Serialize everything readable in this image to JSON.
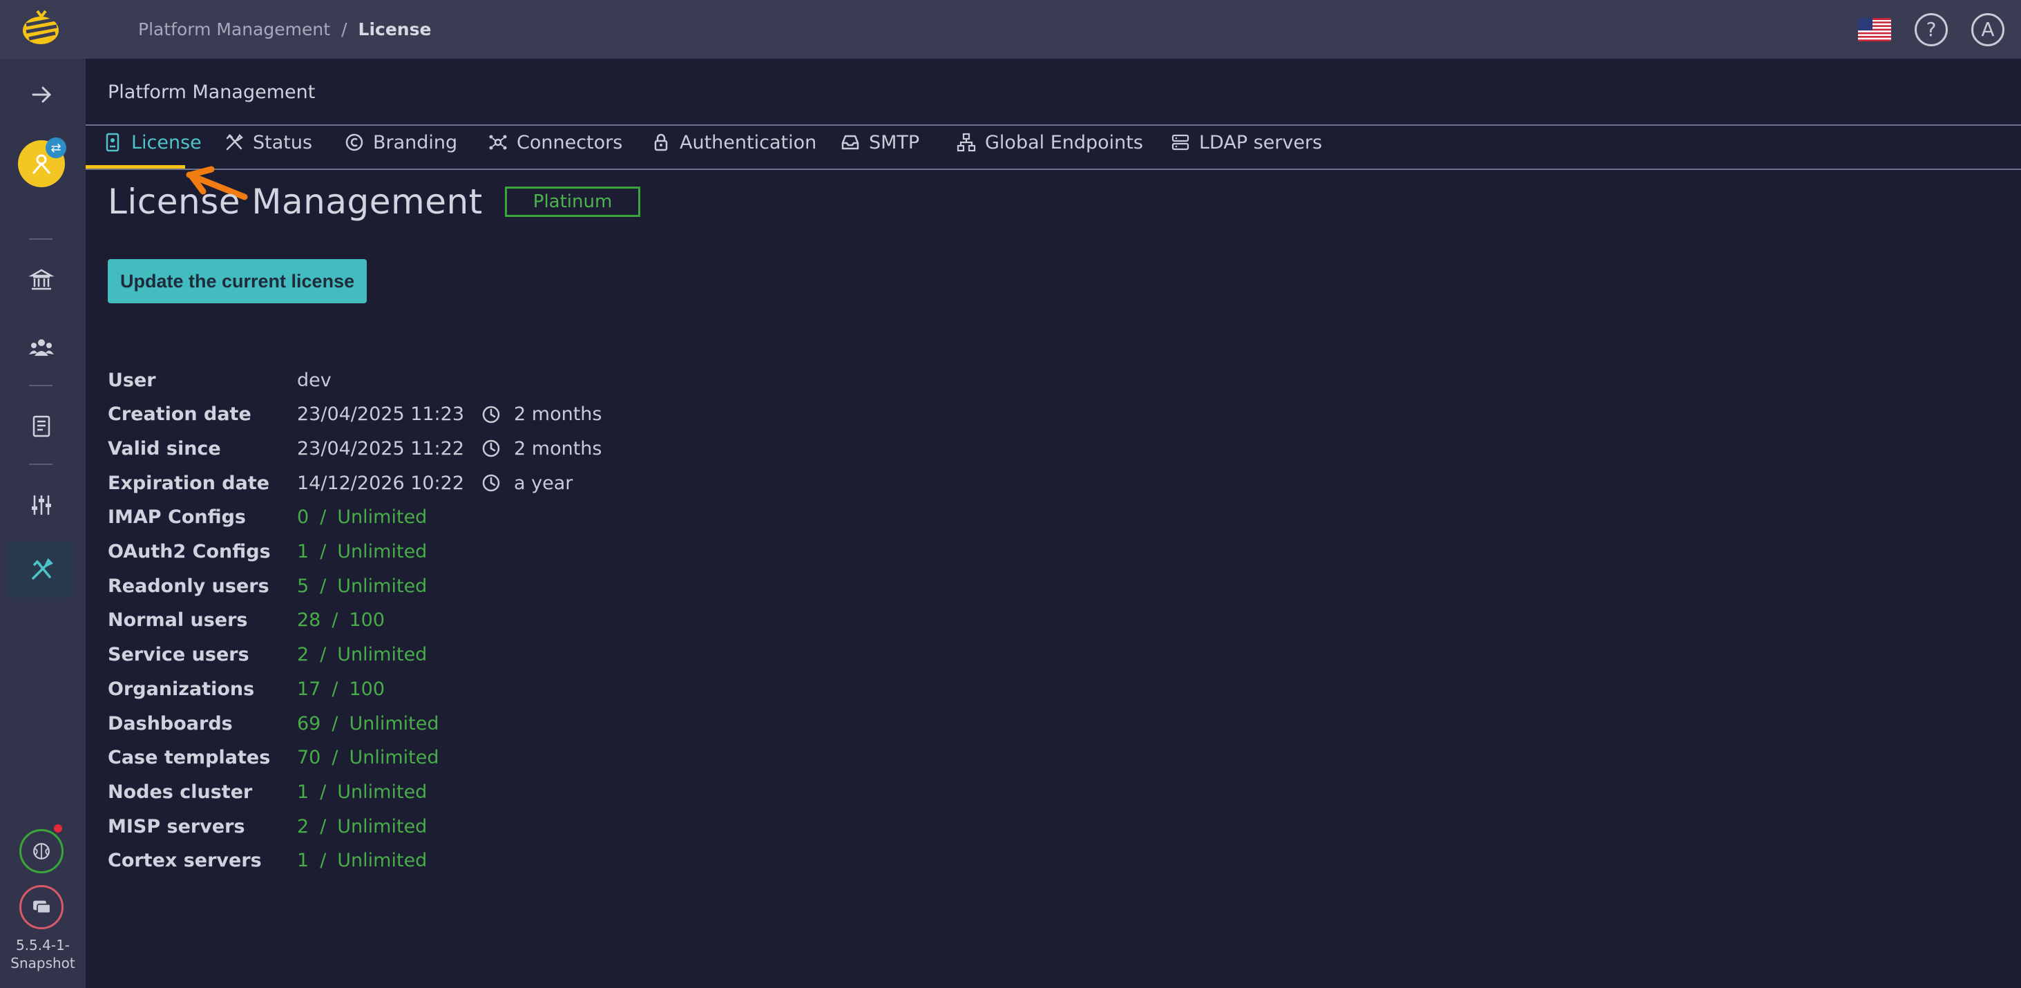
{
  "breadcrumb": {
    "parent": "Platform Management",
    "separator": "/",
    "current": "License"
  },
  "header": {
    "title": "Platform Management"
  },
  "tabs": [
    {
      "label": "License",
      "icon": "license-icon",
      "active": true
    },
    {
      "label": "Status",
      "icon": "tools-icon"
    },
    {
      "label": "Branding",
      "icon": "copyright-icon"
    },
    {
      "label": "Connectors",
      "icon": "connectors-icon"
    },
    {
      "label": "Authentication",
      "icon": "lock-icon"
    },
    {
      "label": "SMTP",
      "icon": "inbox-icon"
    },
    {
      "label": "Global Endpoints",
      "icon": "network-icon"
    },
    {
      "label": "LDAP servers",
      "icon": "server-icon"
    }
  ],
  "license": {
    "title": "License Management",
    "tier": "Platinum",
    "update_button": "Update the current license",
    "user": {
      "label": "User",
      "value": "dev"
    },
    "dates": [
      {
        "label": "Creation date",
        "value": "23/04/2025 11:23",
        "relative": "2 months"
      },
      {
        "label": "Valid since",
        "value": "23/04/2025 11:22",
        "relative": "2 months"
      },
      {
        "label": "Expiration date",
        "value": "14/12/2026 10:22",
        "relative": "a year"
      }
    ],
    "quotas": [
      {
        "label": "IMAP Configs",
        "used": "0",
        "limit": "Unlimited"
      },
      {
        "label": "OAuth2 Configs",
        "used": "1",
        "limit": "Unlimited"
      },
      {
        "label": "Readonly users",
        "used": "5",
        "limit": "Unlimited"
      },
      {
        "label": "Normal users",
        "used": "28",
        "limit": "100"
      },
      {
        "label": "Service users",
        "used": "2",
        "limit": "Unlimited"
      },
      {
        "label": "Organizations",
        "used": "17",
        "limit": "100"
      },
      {
        "label": "Dashboards",
        "used": "69",
        "limit": "Unlimited"
      },
      {
        "label": "Case templates",
        "used": "70",
        "limit": "Unlimited"
      },
      {
        "label": "Nodes cluster",
        "used": "1",
        "limit": "Unlimited"
      },
      {
        "label": "MISP servers",
        "used": "2",
        "limit": "Unlimited"
      },
      {
        "label": "Cortex servers",
        "used": "1",
        "limit": "Unlimited"
      }
    ],
    "quota_separator": "/"
  },
  "sidebar": {
    "version": "5.5.4-1-Snapshot",
    "items": [
      "expand-arrow-icon",
      "organization-icon",
      "users-icon",
      "knowledge-base-icon",
      "settings-sliders-icon",
      "platform-tools-icon"
    ]
  },
  "top_right": {
    "help": "?",
    "avatar": "A"
  },
  "colors": {
    "accent": "#43bcc0",
    "active_tab": "#4ec4c8",
    "tab_underline": "#f4c315",
    "quota": "#47ad47",
    "badge": "#3aa63a"
  }
}
